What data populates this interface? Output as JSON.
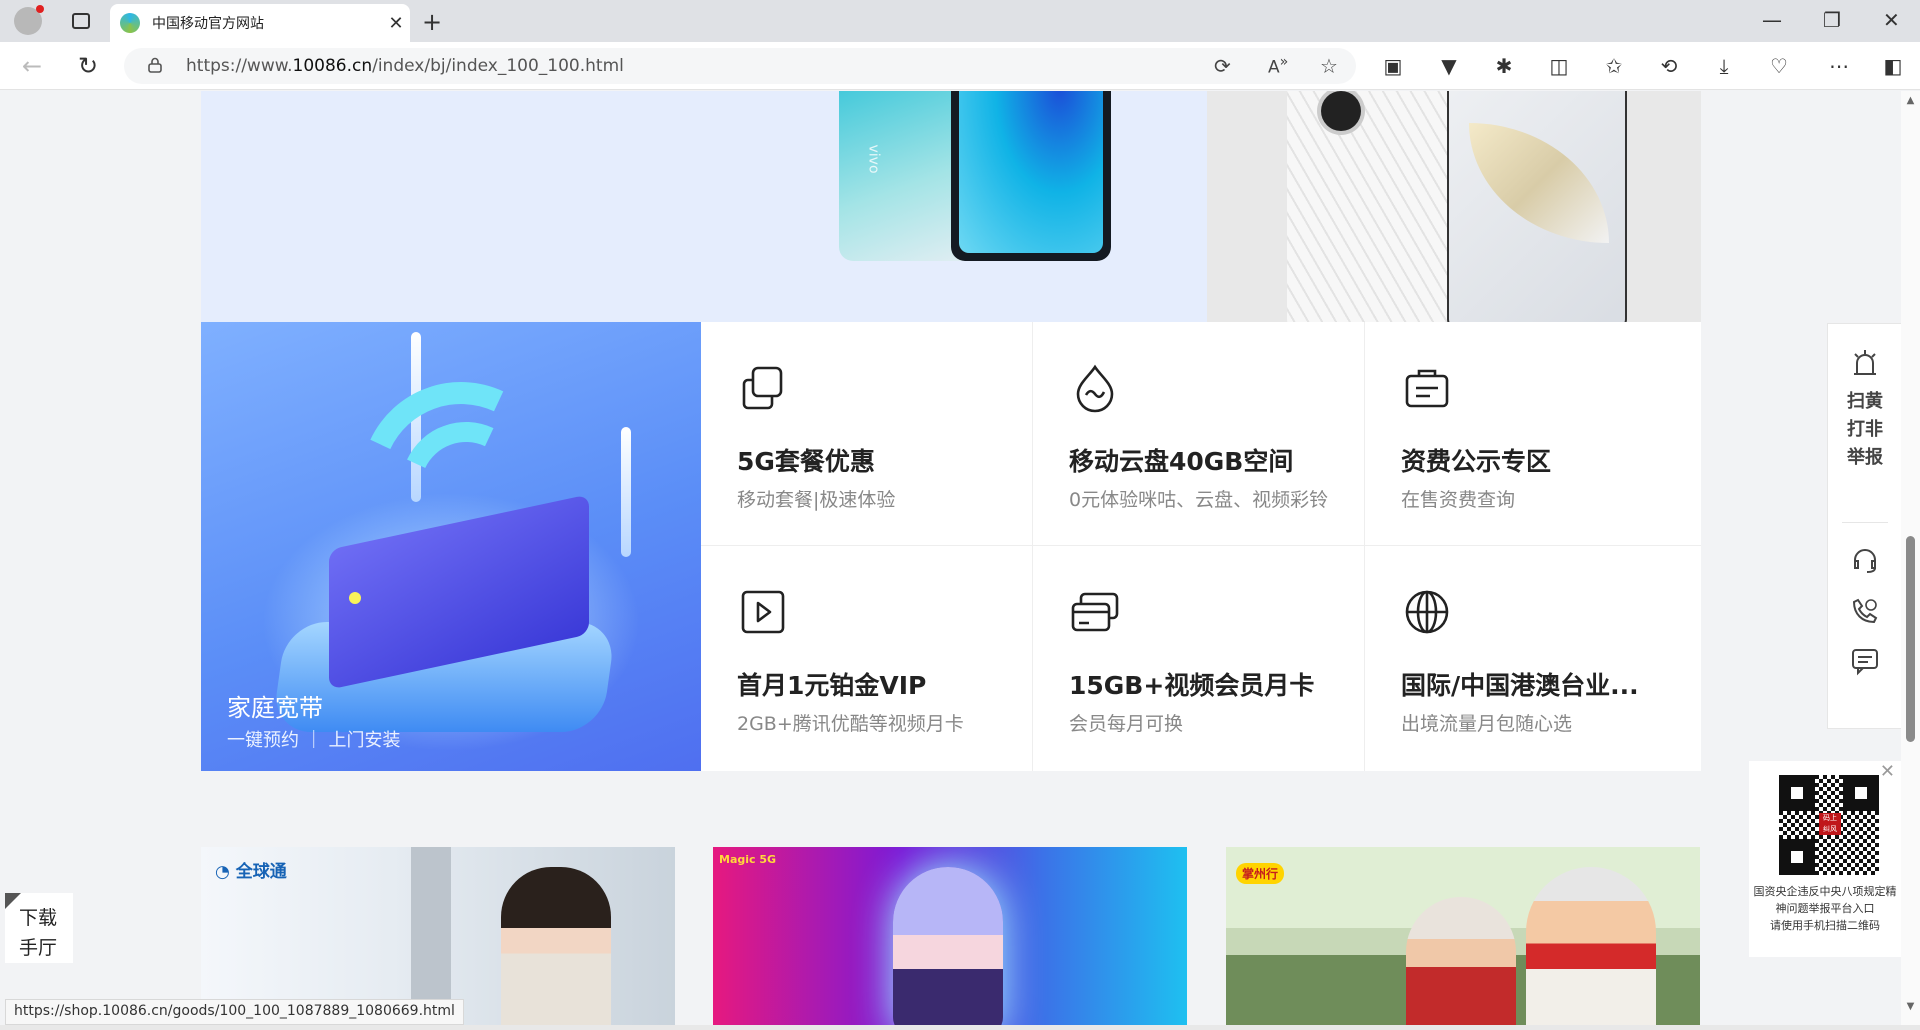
{
  "browser": {
    "tab_title": "中国移动官方网站",
    "tab_close": "✕",
    "new_tab": "+",
    "url_prefix": "https://www.",
    "url_domain": "10086.cn",
    "url_path": "/index/bj/index_100_100.html",
    "window_controls": [
      "—",
      "❐",
      "✕"
    ],
    "toolbar_icons": [
      "extensions-icon",
      "split-screen-icon",
      "favorites-icon",
      "history-icon",
      "downloads-icon",
      "performance-icon",
      "more-icon",
      "sidebar-icon"
    ],
    "status_url": "https://shop.10086.cn/goods/100_100_1087889_1080669.html"
  },
  "hero": {
    "phone_brand": "vivo"
  },
  "broadband": {
    "title": "家庭宽带",
    "subtitle": "一键预约 ｜ 上门安装"
  },
  "services": [
    {
      "title": "5G套餐优惠",
      "subtitle": "移动套餐|极速体验",
      "icon": "copy-icon"
    },
    {
      "title": "移动云盘40GB空间",
      "subtitle": "0元体验咪咕、云盘、视频彩铃",
      "icon": "cloud-drop-icon"
    },
    {
      "title": "资费公示专区",
      "subtitle": "在售资费查询",
      "icon": "briefcase-icon"
    },
    {
      "title": "首月1元铂金VIP",
      "subtitle": "2GB+腾讯优酷等视频月卡",
      "icon": "play-icon"
    },
    {
      "title": "15GB+视频会员月卡",
      "subtitle": "会员每月可换",
      "icon": "card-icon"
    },
    {
      "title": "国际/中国港澳台业...",
      "subtitle": "出境流量月包随心选",
      "icon": "globe-icon"
    }
  ],
  "promos": {
    "global_logo": "全球通",
    "game_badge": "Magic 5G",
    "tag": "掌州行"
  },
  "sidebar": {
    "report_label": "扫黄打非举报",
    "icons": [
      "customer-service-icon",
      "phone-icon",
      "message-icon"
    ]
  },
  "qr": {
    "close": "✕",
    "logo_text": "码上\n纠风",
    "text": "国资央企违反中央八项规定精神问题举报平台入口",
    "hint": "请使用手机扫描二维码"
  },
  "download": {
    "label": "下载手厅"
  }
}
